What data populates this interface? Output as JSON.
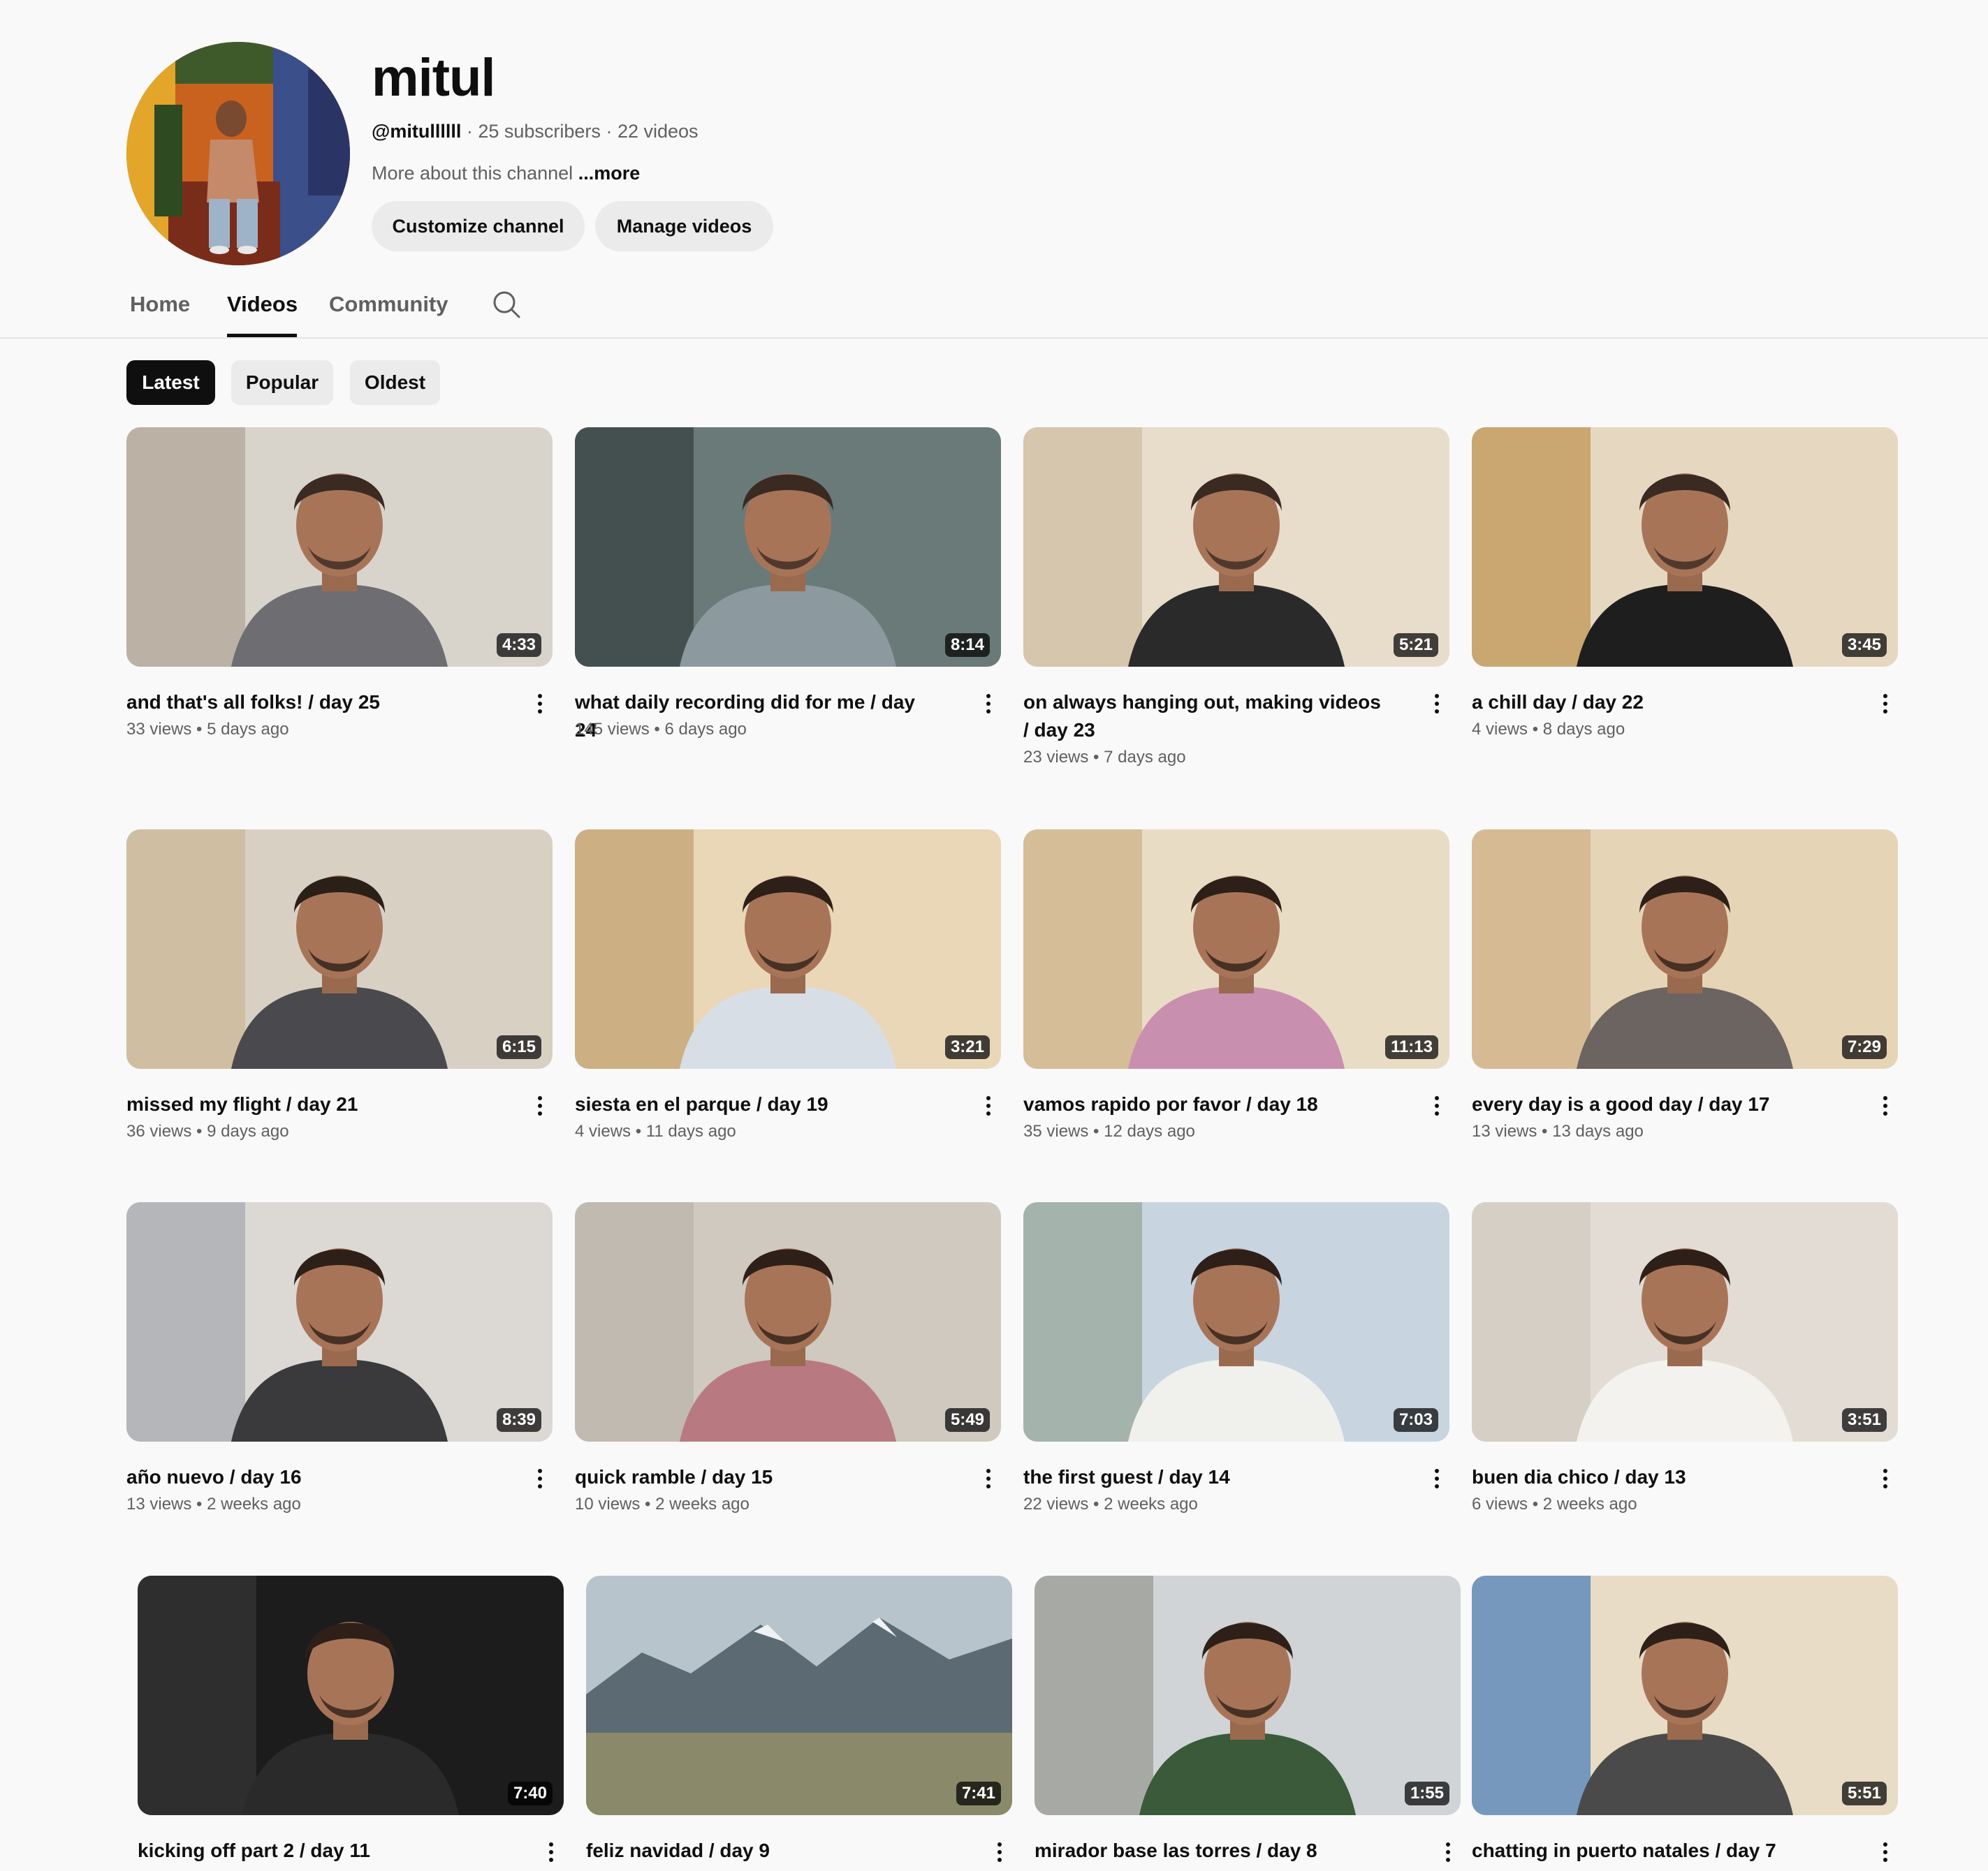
{
  "channel": {
    "name": "mitul",
    "handle": "@mitullllll",
    "subscribers": "25 subscribers",
    "video_count": "22 videos",
    "separator": " · ",
    "about": "More about this channel",
    "more_label": "...more",
    "customize_label": "Customize channel",
    "manage_label": "Manage videos"
  },
  "tabs": [
    {
      "label": "Home"
    },
    {
      "label": "Videos"
    },
    {
      "label": "Community"
    }
  ],
  "active_tab": "Videos",
  "filters": [
    {
      "label": "Latest"
    },
    {
      "label": "Popular"
    },
    {
      "label": "Oldest"
    }
  ],
  "active_filter": "Latest",
  "meta_dot": " • ",
  "videos": [
    {
      "title": "and that's all folks! / day 25",
      "views": "33 views",
      "age": "5 days ago",
      "duration": "4:33"
    },
    {
      "title": "what daily recording did for me / day 24",
      "views": "145 views",
      "age": "6 days ago",
      "duration": "8:14"
    },
    {
      "title": "on always hanging out, making videos / day 23",
      "views": "23 views",
      "age": "7 days ago",
      "duration": "5:21"
    },
    {
      "title": "a chill day / day 22",
      "views": "4 views",
      "age": "8 days ago",
      "duration": "3:45"
    },
    {
      "title": "missed my flight / day 21",
      "views": "36 views",
      "age": "9 days ago",
      "duration": "6:15"
    },
    {
      "title": "siesta en el parque / day 19",
      "views": "4 views",
      "age": "11 days ago",
      "duration": "3:21"
    },
    {
      "title": "vamos rapido por favor / day 18",
      "views": "35 views",
      "age": "12 days ago",
      "duration": "11:13"
    },
    {
      "title": "every day is a good day / day 17",
      "views": "13 views",
      "age": "13 days ago",
      "duration": "7:29"
    },
    {
      "title": "año nuevo / day 16",
      "views": "13 views",
      "age": "2 weeks ago",
      "duration": "8:39"
    },
    {
      "title": "quick ramble / day 15",
      "views": "10 views",
      "age": "2 weeks ago",
      "duration": "5:49"
    },
    {
      "title": "the first guest / day 14",
      "views": "22 views",
      "age": "2 weeks ago",
      "duration": "7:03"
    },
    {
      "title": "buen dia chico / day 13",
      "views": "6 views",
      "age": "2 weeks ago",
      "duration": "3:51"
    },
    {
      "title": "kicking off part 2 / day 11",
      "views": "",
      "age": "",
      "duration": "7:40"
    },
    {
      "title": "feliz navidad / day 9",
      "views": "",
      "age": "",
      "duration": "7:41"
    },
    {
      "title": "mirador base las torres / day 8",
      "views": "",
      "age": "",
      "duration": "1:55"
    },
    {
      "title": "chatting in puerto natales / day 7",
      "views": "",
      "age": "",
      "duration": "5:51"
    }
  ],
  "colors": {
    "background": "#f9f9f9",
    "text_primary": "#0f0f0f",
    "text_secondary": "#606060",
    "chip_bg": "#ebebeb",
    "chip_active_bg": "#0f0f0f"
  },
  "icons": {
    "search": "search-icon",
    "more": "more-vert-icon"
  }
}
